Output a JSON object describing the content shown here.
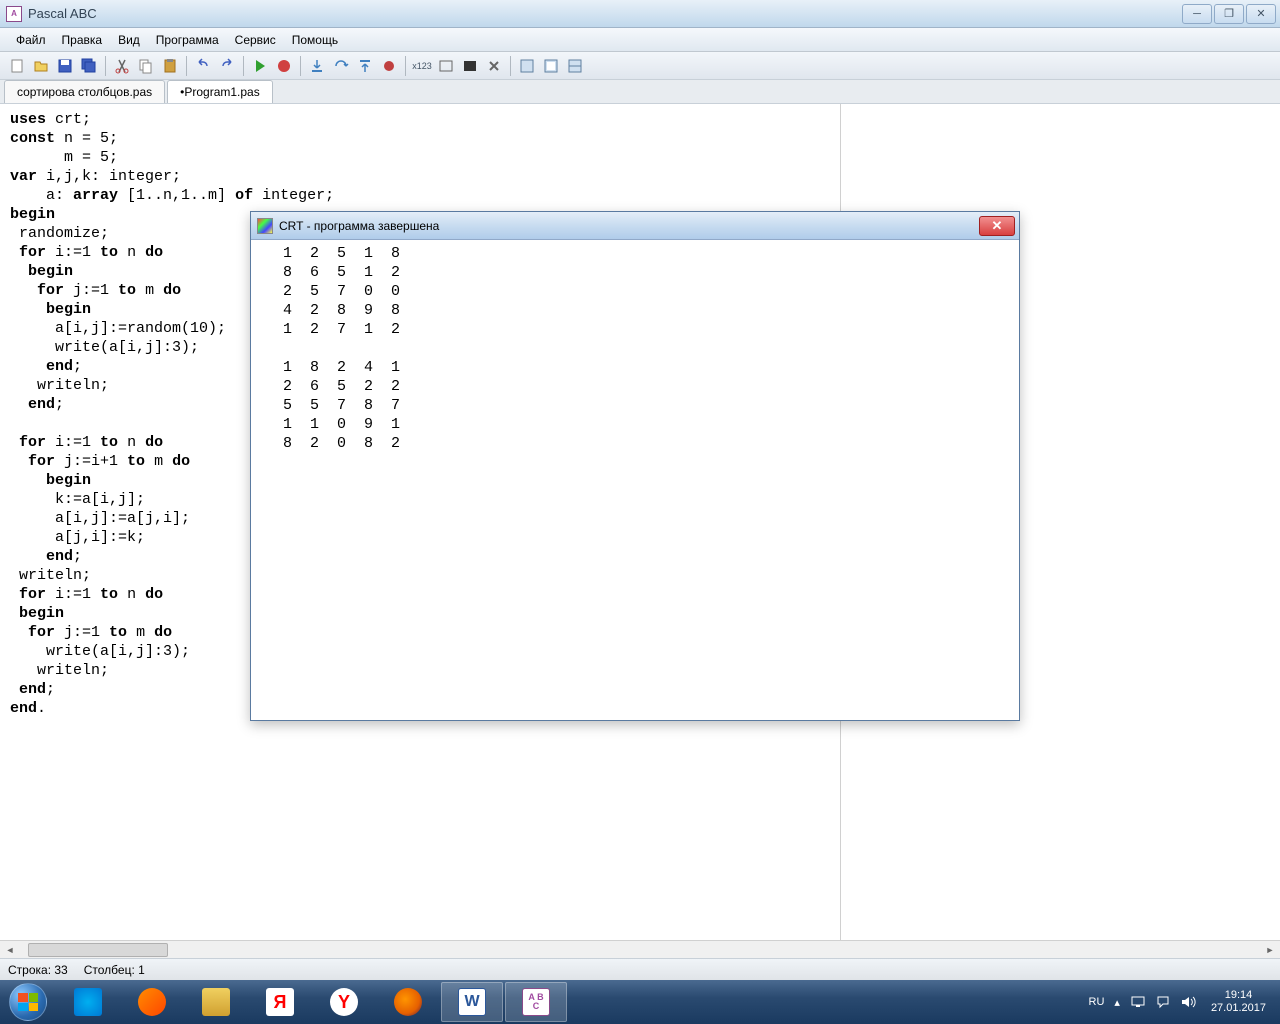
{
  "title": "Pascal ABC",
  "menu": [
    "Файл",
    "Правка",
    "Вид",
    "Программа",
    "Сервис",
    "Помощь"
  ],
  "tabs": [
    {
      "label": "сортирова столбцов.pas",
      "active": false,
      "dirty": false
    },
    {
      "label": "Program1.pas",
      "active": true,
      "dirty": true
    }
  ],
  "code_tokens": [
    [
      [
        "kw",
        "uses"
      ],
      [
        "",
        " crt;"
      ]
    ],
    [
      [
        "kw",
        "const"
      ],
      [
        "",
        " n = 5;"
      ]
    ],
    [
      [
        "",
        "      m = 5;"
      ]
    ],
    [
      [
        "kw",
        "var"
      ],
      [
        "",
        " i,j,k: integer;"
      ]
    ],
    [
      [
        "",
        "    a: "
      ],
      [
        "kw",
        "array"
      ],
      [
        "",
        " [1..n,1..m] "
      ],
      [
        "kw",
        "of"
      ],
      [
        "",
        " integer;"
      ]
    ],
    [
      [
        "kw",
        "begin"
      ]
    ],
    [
      [
        "",
        " randomize;"
      ]
    ],
    [
      [
        "",
        " "
      ],
      [
        "kw",
        "for"
      ],
      [
        "",
        " i:=1 "
      ],
      [
        "kw",
        "to"
      ],
      [
        "",
        " n "
      ],
      [
        "kw",
        "do"
      ]
    ],
    [
      [
        "",
        "  "
      ],
      [
        "kw",
        "begin"
      ]
    ],
    [
      [
        "",
        "   "
      ],
      [
        "kw",
        "for"
      ],
      [
        "",
        " j:=1 "
      ],
      [
        "kw",
        "to"
      ],
      [
        "",
        " m "
      ],
      [
        "kw",
        "do"
      ]
    ],
    [
      [
        "",
        "    "
      ],
      [
        "kw",
        "begin"
      ]
    ],
    [
      [
        "",
        "     a[i,j]:=random(10);"
      ]
    ],
    [
      [
        "",
        "     write(a[i,j]:3);"
      ]
    ],
    [
      [
        "",
        "    "
      ],
      [
        "kw",
        "end"
      ],
      [
        "",
        ";"
      ]
    ],
    [
      [
        "",
        "   writeln;"
      ]
    ],
    [
      [
        "",
        "  "
      ],
      [
        "kw",
        "end"
      ],
      [
        "",
        ";"
      ]
    ],
    [
      [
        "",
        ""
      ]
    ],
    [
      [
        "",
        " "
      ],
      [
        "kw",
        "for"
      ],
      [
        "",
        " i:=1 "
      ],
      [
        "kw",
        "to"
      ],
      [
        "",
        " n "
      ],
      [
        "kw",
        "do"
      ]
    ],
    [
      [
        "",
        "  "
      ],
      [
        "kw",
        "for"
      ],
      [
        "",
        " j:=i+1 "
      ],
      [
        "kw",
        "to"
      ],
      [
        "",
        " m "
      ],
      [
        "kw",
        "do"
      ]
    ],
    [
      [
        "",
        "    "
      ],
      [
        "kw",
        "begin"
      ]
    ],
    [
      [
        "",
        "     k:=a[i,j];"
      ]
    ],
    [
      [
        "",
        "     a[i,j]:=a[j,i];"
      ]
    ],
    [
      [
        "",
        "     a[j,i]:=k;"
      ]
    ],
    [
      [
        "",
        "    "
      ],
      [
        "kw",
        "end"
      ],
      [
        "",
        ";"
      ]
    ],
    [
      [
        "",
        " writeln;"
      ]
    ],
    [
      [
        "",
        " "
      ],
      [
        "kw",
        "for"
      ],
      [
        "",
        " i:=1 "
      ],
      [
        "kw",
        "to"
      ],
      [
        "",
        " n "
      ],
      [
        "kw",
        "do"
      ]
    ],
    [
      [
        "",
        " "
      ],
      [
        "kw",
        "begin"
      ]
    ],
    [
      [
        "",
        "  "
      ],
      [
        "kw",
        "for"
      ],
      [
        "",
        " j:=1 "
      ],
      [
        "kw",
        "to"
      ],
      [
        "",
        " m "
      ],
      [
        "kw",
        "do"
      ]
    ],
    [
      [
        "",
        "    write(a[i,j]:3);"
      ]
    ],
    [
      [
        "",
        "   writeln;"
      ]
    ],
    [
      [
        "",
        " "
      ],
      [
        "kw",
        "end"
      ],
      [
        "",
        ";"
      ]
    ],
    [
      [
        "kw",
        "end"
      ],
      [
        "",
        "."
      ]
    ]
  ],
  "crt": {
    "title": "CRT - программа завершена",
    "output": "  1  2  5  1  8\n  8  6  5  1  2\n  2  5  7  0  0\n  4  2  8  9  8\n  1  2  7  1  2\n\n  1  8  2  4  1\n  2  6  5  2  2\n  5  5  7  8  7\n  1  1  0  9  1\n  8  2  0  8  2"
  },
  "status": {
    "line_label": "Строка: 33",
    "col_label": "Столбец: 1"
  },
  "tray": {
    "lang": "RU",
    "time": "19:14",
    "date": "27.01.2017"
  }
}
